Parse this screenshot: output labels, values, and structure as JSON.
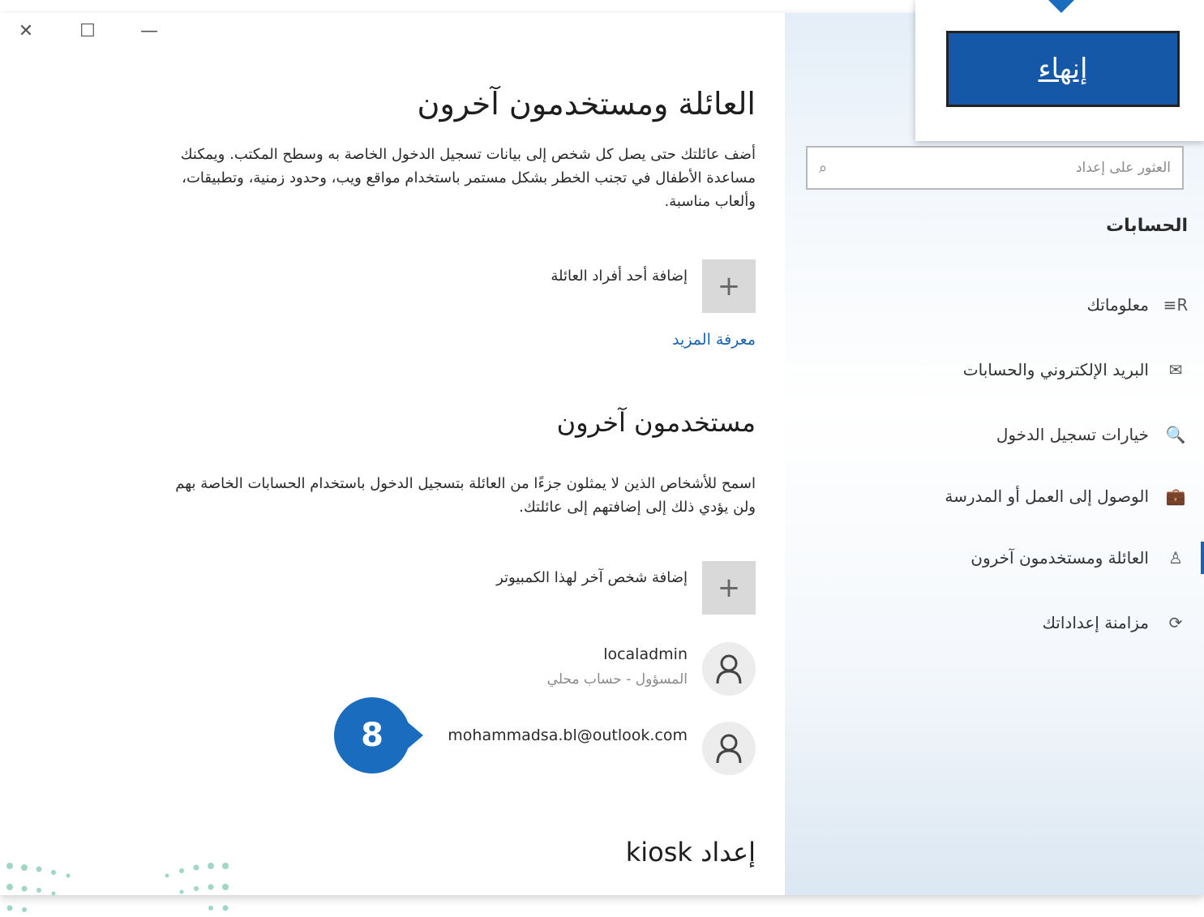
{
  "window": {
    "controls": [
      "✕",
      "☐",
      "—"
    ]
  },
  "popup": {
    "finish_label": "إنهاء"
  },
  "nav": {
    "search_placeholder": "العثور على إعداد",
    "heading": "الحسابات",
    "items": [
      {
        "label": "معلوماتك",
        "icon": "user-info-icon",
        "glyph": "R≡"
      },
      {
        "label": "البريد الإلكتروني والحسابات",
        "icon": "mail-icon",
        "glyph": "✉"
      },
      {
        "label": "خيارات تسجيل الدخول",
        "icon": "key-icon",
        "glyph": "🔍"
      },
      {
        "label": "الوصول إلى العمل أو المدرسة",
        "icon": "briefcase-icon",
        "glyph": "💼"
      },
      {
        "label": "العائلة ومستخدمون آخرون",
        "icon": "person-icon",
        "glyph": "♙"
      },
      {
        "label": "مزامنة إعداداتك",
        "icon": "sync-icon",
        "glyph": "⟳"
      }
    ],
    "selected_index": 4
  },
  "main": {
    "title": "العائلة ومستخدمون آخرون",
    "family_desc": "أضف عائلتك حتى يصل كل شخص إلى بيانات تسجيل الدخول الخاصة به وسطح المكتب. ويمكنك مساعدة الأطفال في تجنب الخطر بشكل مستمر باستخدام مواقع ويب، وحدود زمنية، وتطبيقات، وألعاب مناسبة.",
    "add_family_label": "إضافة أحد أفراد العائلة",
    "learn_more": "معرفة المزيد",
    "other_users_title": "مستخدمون آخرون",
    "other_users_desc": "اسمح للأشخاص الذين لا يمثلون جزءًا من العائلة بتسجيل الدخول باستخدام الحسابات الخاصة بهم ولن يؤدي ذلك إلى إضافتهم إلى عائلتك.",
    "add_other_label": "إضافة شخص آخر لهذا الكمبيوتر",
    "accounts": [
      {
        "name": "localadmin",
        "sub": "المسؤول - حساب محلي"
      },
      {
        "name": "mohammadsa.bl@outlook.com",
        "sub": ""
      }
    ],
    "kiosk_title": "إعداد kiosk"
  },
  "step_badge": "8",
  "colors": {
    "accent": "#1a6cbe",
    "finish_button": "#1558a8"
  }
}
